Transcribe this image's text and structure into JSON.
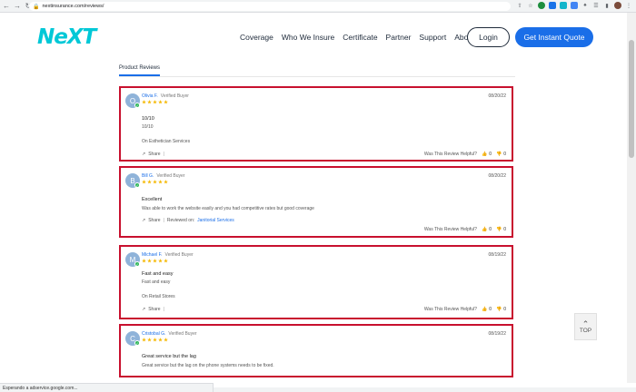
{
  "browser": {
    "url": "nextinsurance.com/reviews/",
    "status_text": "Esperando a adservice.google.com..."
  },
  "header": {
    "logo": "NeXT",
    "menu": [
      "Coverage",
      "Who We Insure",
      "Certificate",
      "Partner",
      "Support",
      "About Us"
    ],
    "login_label": "Login",
    "quote_label": "Get Instant Quote"
  },
  "section_tab": "Product Reviews",
  "share_label": "Share",
  "helpful_label": "Was This Review Helpful?",
  "reviews": [
    {
      "initial": "O",
      "name": "Olivia F.",
      "verified": "Verified Buyer",
      "date": "08/20/22",
      "title": "10/10",
      "body": "10/10",
      "service": "On Esthetician Services",
      "up": "0",
      "down": "0"
    },
    {
      "initial": "B",
      "name": "Bill G.",
      "verified": "Verified Buyer",
      "date": "08/20/22",
      "title": "Excellent",
      "body": "Was able to work the website easily and you had competitive rates but good coverage",
      "reviewed_on": "Reviewed on:",
      "reviewed_service": "Janitorial Services",
      "up": "0",
      "down": "0"
    },
    {
      "initial": "M",
      "name": "Michael F.",
      "verified": "Verified Buyer",
      "date": "08/19/22",
      "title": "Fast and easy",
      "body": "Fast and easy",
      "service": "On Retail Stores",
      "up": "0",
      "down": "0"
    },
    {
      "initial": "C",
      "name": "Cristobal G.",
      "verified": "Verified Buyer",
      "date": "08/19/22",
      "title": "Great service but the lag",
      "body": "Great service but the lag on the phone systems needs to be fixed."
    }
  ],
  "top_button_label": "TOP",
  "colors": {
    "brand": "#00c8d7",
    "accent": "#1a6ee8",
    "highlight": "#c8102e",
    "star": "#f5b800"
  }
}
